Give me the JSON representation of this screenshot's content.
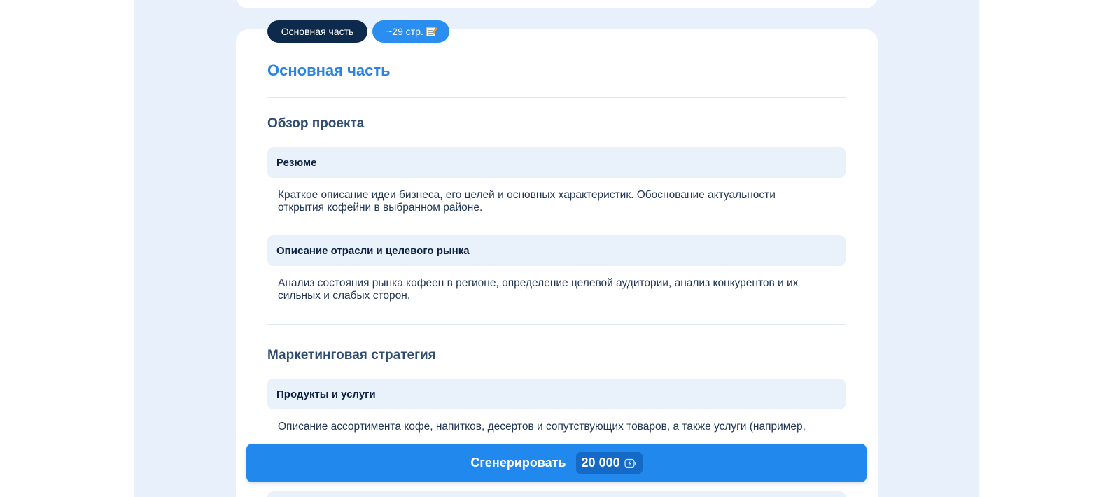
{
  "badges": {
    "section": "Основная часть",
    "pages": "~29 стр.",
    "pages_icon": "memo-icon"
  },
  "main": {
    "title": "Основная часть",
    "sections": [
      {
        "heading": "Обзор проекта",
        "subsections": [
          {
            "title": "Резюме",
            "text_lines": [
              "Краткое описание идеи бизнеса, его целей и основных характеристик. Обоснование актуальности",
              "открытия кофейни в выбранном районе."
            ]
          },
          {
            "title": "Описание отрасли и целевого рынка",
            "text_lines": [
              "Анализ состояния рынка кофеен в регионе, определение целевой аудитории, анализ конкурентов и их",
              "сильных и слабых сторон."
            ]
          }
        ]
      },
      {
        "heading": "Маркетинговая стратегия",
        "subsections": [
          {
            "title": "Продукты и услуги",
            "text_lines": [
              "Описание ассортимента кофе, напитков, десертов и сопутствующих товаров, а также услуги (например,"
            ]
          }
        ]
      }
    ]
  },
  "generate_button": {
    "label": "Сгенерировать",
    "price": "20 000",
    "price_icon": "lightning-credit-icon"
  },
  "colors": {
    "accent": "#2189ee",
    "title": "#2784e6",
    "dark_badge": "#0d2a4c",
    "backdrop": "#e8f0fb",
    "subsection_bg": "#e9f1fb"
  }
}
